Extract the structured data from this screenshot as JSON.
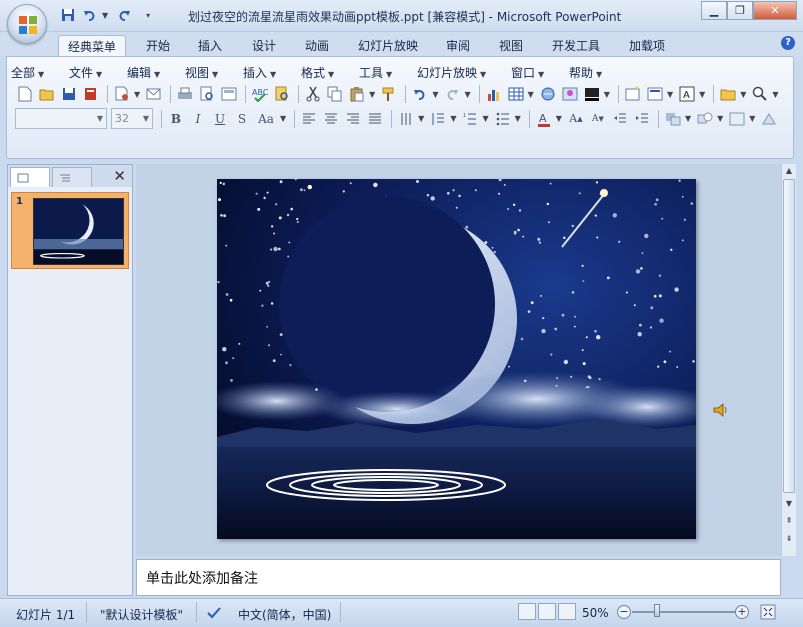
{
  "window": {
    "title": "划过夜空的流星流星雨效果动画ppt模板.ppt [兼容模式] - Microsoft PowerPoint"
  },
  "tabs": [
    "经典菜单",
    "开始",
    "插入",
    "设计",
    "动画",
    "幻灯片放映",
    "审阅",
    "视图",
    "开发工具",
    "加载项"
  ],
  "active_tab": "经典菜单",
  "classic_menu": [
    "全部",
    "文件",
    "编辑",
    "视图",
    "插入",
    "格式",
    "工具",
    "幻灯片放映",
    "窗口",
    "帮助"
  ],
  "font_combo": {
    "name": "",
    "size": "32"
  },
  "slide_panel": {
    "slide_number": "1"
  },
  "notes": {
    "placeholder": "单击此处添加备注"
  },
  "status": {
    "slide_info": "幻灯片 1/1",
    "theme": "\"默认设计模板\"",
    "language": "中文(简体，中国)",
    "zoom": "50%",
    "zoom_level": 0.5
  },
  "colors": {
    "accent": "#f3b16c",
    "ribbon": "#dfe9f6",
    "sky": "#0b1a4a"
  }
}
